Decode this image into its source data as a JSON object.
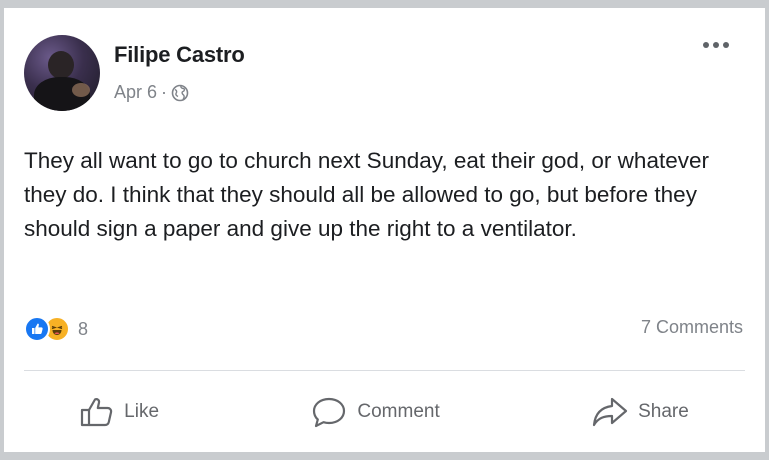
{
  "post": {
    "author": "Filipe Castro",
    "date": "Apr 6",
    "separator": "·",
    "privacy_icon": "globe-icon",
    "text": "They all want to go to church next Sunday, eat their god, or whatever they do. I think that they should all be allowed to go, but before they should sign a paper and give up the right to a ventilator."
  },
  "reactions": {
    "icons": [
      "like-reaction-icon",
      "haha-reaction-icon"
    ],
    "count": "8"
  },
  "comments": {
    "label": "7 Comments"
  },
  "actions": {
    "like": "Like",
    "comment": "Comment",
    "share": "Share"
  },
  "colors": {
    "like_blue": "#1877f2",
    "haha_yellow": "#f7b125",
    "secondary_text": "#7f8389",
    "primary_text": "#1c1e21"
  }
}
